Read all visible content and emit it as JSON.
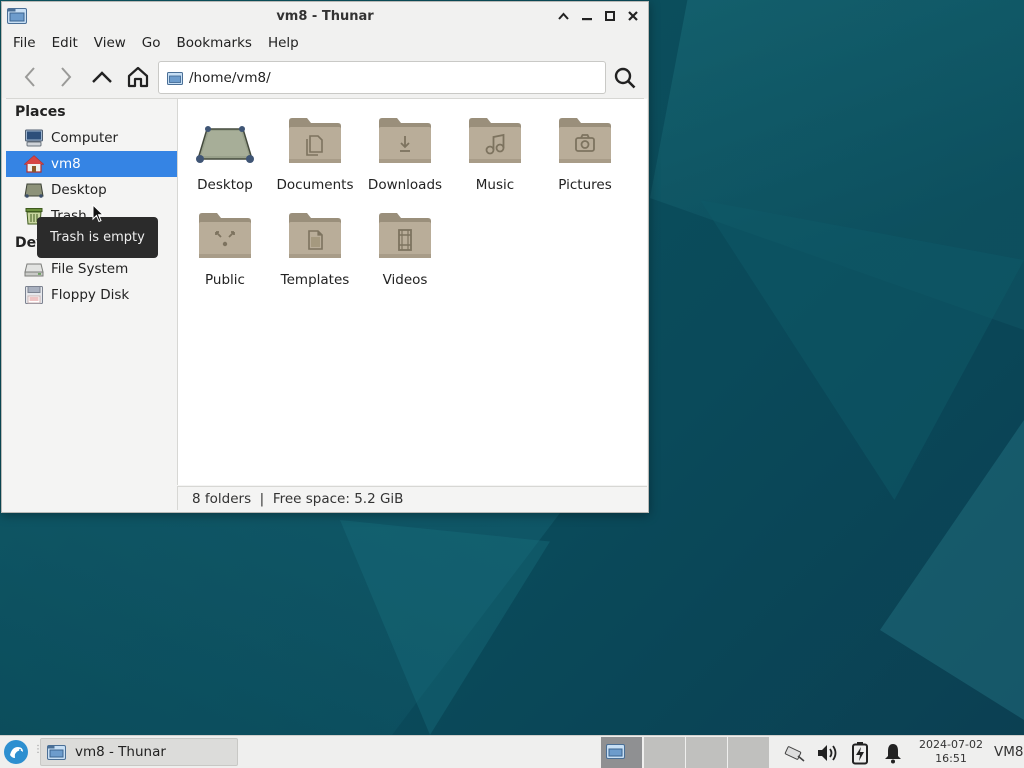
{
  "window": {
    "title": "vm8 - Thunar",
    "controls": {
      "minimize": "⌃",
      "restore": "—",
      "maximize": "◻",
      "close": "✕"
    }
  },
  "menubar": [
    "File",
    "Edit",
    "View",
    "Go",
    "Bookmarks",
    "Help"
  ],
  "location": {
    "path": "/home/vm8/"
  },
  "sidebar": {
    "places_title": "Places",
    "places": [
      {
        "label": "Computer",
        "icon": "computer-icon"
      },
      {
        "label": "vm8",
        "icon": "home-icon",
        "selected": true
      },
      {
        "label": "Desktop",
        "icon": "desktop-icon"
      },
      {
        "label": "Trash",
        "icon": "trash-icon"
      }
    ],
    "devices_title": "Devices",
    "devices": [
      {
        "label": "File System",
        "icon": "drive-icon"
      },
      {
        "label": "Floppy Disk",
        "icon": "floppy-icon"
      }
    ]
  },
  "files": [
    {
      "label": "Desktop",
      "icon": "desktop-folder-icon"
    },
    {
      "label": "Documents",
      "icon": "documents-folder-icon"
    },
    {
      "label": "Downloads",
      "icon": "downloads-folder-icon"
    },
    {
      "label": "Music",
      "icon": "music-folder-icon"
    },
    {
      "label": "Pictures",
      "icon": "pictures-folder-icon"
    },
    {
      "label": "Public",
      "icon": "public-folder-icon"
    },
    {
      "label": "Templates",
      "icon": "templates-folder-icon"
    },
    {
      "label": "Videos",
      "icon": "videos-folder-icon"
    }
  ],
  "statusbar": {
    "text": "8 folders  |  Free space: 5.2 GiB"
  },
  "tooltip": {
    "text": "Trash is empty"
  },
  "taskbar": {
    "task_label": "vm8 - Thunar",
    "clock_date": "2024-07-02",
    "clock_time": "16:51",
    "user": "VM8"
  },
  "colors": {
    "selection": "#3584e4",
    "folder": "#b9ad99",
    "desktop_bg": "#0b4e5c"
  }
}
